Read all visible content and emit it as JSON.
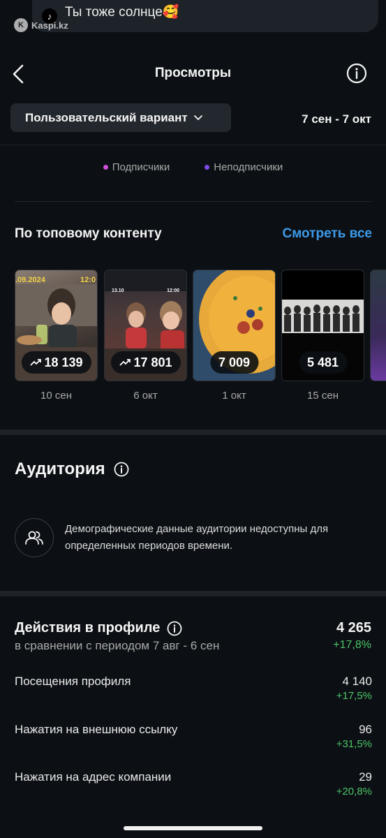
{
  "notification": {
    "text": "Ты тоже солнце🥰",
    "watermark": "Kaspi.kz"
  },
  "header": {
    "title": "Просмотры"
  },
  "filters": {
    "variant_label": "Пользовательский вариант",
    "date_range": "7 сен - 7 окт"
  },
  "legend": {
    "items": [
      {
        "label": "Подписчики",
        "color": "#d24fd9"
      },
      {
        "label": "Неподписчики",
        "color": "#7a4ce8"
      }
    ]
  },
  "top_content": {
    "title": "По топовому контенту",
    "see_all": "Смотреть все",
    "items": [
      {
        "views": "18 139",
        "date": "10 сен",
        "trend": true,
        "overlay_left": ".09.2024",
        "overlay_right": "12:0"
      },
      {
        "views": "17 801",
        "date": "6 окт",
        "trend": true,
        "overlay_left": "13.10",
        "overlay_right": "12:00"
      },
      {
        "views": "7 009",
        "date": "1 окт",
        "trend": false
      },
      {
        "views": "5 481",
        "date": "15 сен",
        "trend": false
      }
    ]
  },
  "audience": {
    "title": "Аудитория",
    "message": "Демографические данные аудитории недоступны для определенных периодов времени."
  },
  "profile_actions": {
    "title": "Действия в профиле",
    "total": "4 265",
    "comparison": "в сравнении с периодом 7 авг - 6 сен",
    "total_delta": "+17,8%",
    "metrics": [
      {
        "label": "Посещения профиля",
        "value": "4 140",
        "delta": "+17,5%"
      },
      {
        "label": "Нажатия на внешнюю ссылку",
        "value": "96",
        "delta": "+31,5%"
      },
      {
        "label": "Нажатия на адрес компании",
        "value": "29",
        "delta": "+20,8%"
      }
    ]
  },
  "colors": {
    "background": "#0c1014",
    "accent_link": "#3d9aea",
    "positive": "#4cc368"
  }
}
